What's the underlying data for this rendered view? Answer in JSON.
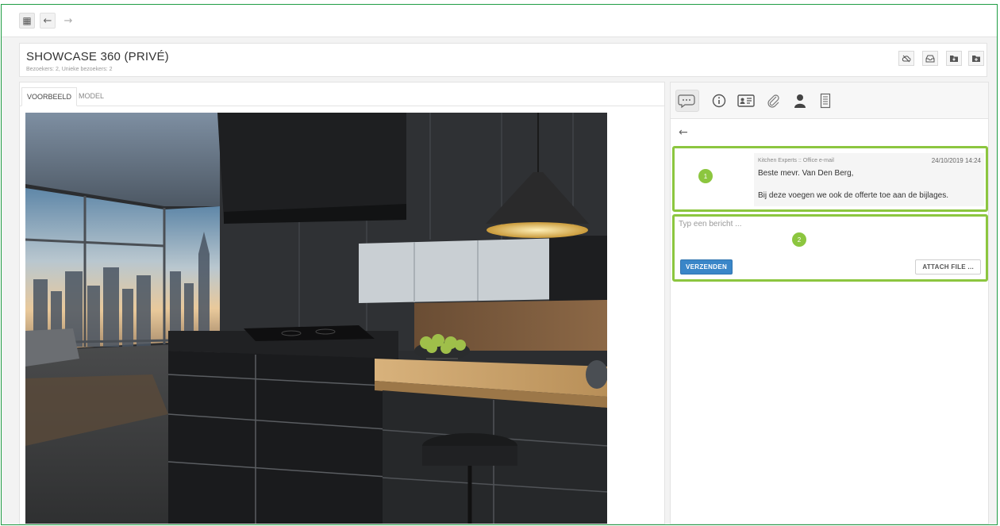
{
  "toolbar": {
    "apps_icon": "grid-icon",
    "back_icon": "arrow-left-icon",
    "forward_icon": "arrow-right-icon"
  },
  "header": {
    "title": "SHOWCASE 360 (PRIVÉ)",
    "subtitle": "Bezoekers: 2, Unieke bezoekers: 2",
    "actions": [
      "cloud-off-icon",
      "inbox-icon",
      "folder-download-icon",
      "folder-add-icon"
    ]
  },
  "preview": {
    "tabs": [
      {
        "label": "VOORBEELD",
        "active": true
      },
      {
        "label": "MODEL",
        "active": false
      }
    ],
    "image": "kitchen-360-render"
  },
  "sidepanel": {
    "tabs": [
      "chat-icon",
      "info-icon",
      "contact-card-icon",
      "paperclip-icon",
      "user-icon",
      "document-icon"
    ],
    "active_tab": "chat-icon",
    "back_icon": "arrow-left-icon",
    "message": {
      "sender": "Kitchen Experts :: Office e-mail",
      "datetime": "24/10/2019 14:24",
      "greeting": "Beste mevr. Van Den Berg,",
      "body": "Bij deze voegen we ook de offerte toe aan de bijlages."
    },
    "composer": {
      "placeholder": "Typ een bericht ...",
      "value": "",
      "send_label": "VERZENDEN",
      "attach_label": "ATTACH FILE ..."
    },
    "markers": [
      "1",
      "2"
    ]
  },
  "colors": {
    "frame_border": "#1f9d44",
    "highlight": "#8cc63f",
    "primary_button": "#3a86c8"
  }
}
